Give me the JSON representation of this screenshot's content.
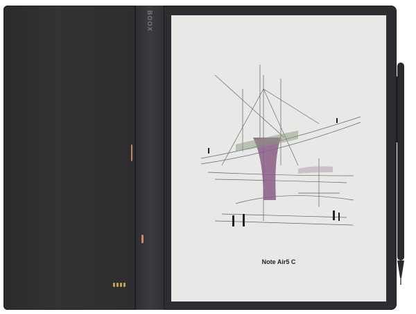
{
  "device": {
    "brand_logo": "BOOX",
    "screen_caption": "Note Air5 C",
    "colors": {
      "body": "#2c2d30",
      "screen": "#e8e8e6",
      "accent_copper": "#c2846a",
      "stylus": "#2a2b2d",
      "pogo_pins": "#c9a14a"
    }
  }
}
